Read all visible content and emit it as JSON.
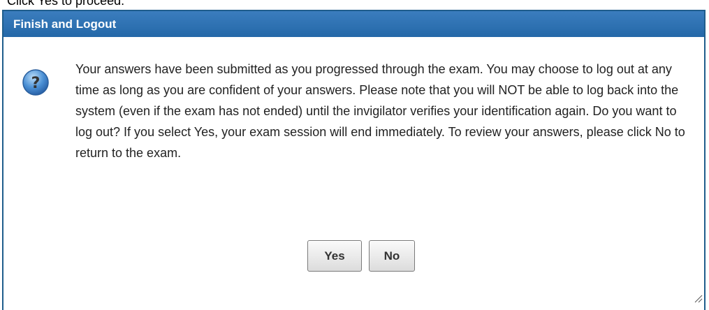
{
  "top_caption": "Click Yes to proceed.",
  "dialog": {
    "title": "Finish and Logout",
    "message": "Your answers have been submitted as you progressed through the exam. You may choose to log out at any time as long as you are confident of your answers. Please note that you will NOT be able to log back into the system (even if the exam has not ended) until the invigilator verifies your identification again. Do you want to log out? If you select Yes, your exam session will end immediately. To review your answers, please click No to return to the exam.",
    "buttons": {
      "yes_label": "Yes",
      "no_label": "No"
    },
    "icon": "question-icon"
  },
  "colors": {
    "title_bar": "#2a6fb0",
    "border": "#1f5d8c",
    "icon_blue": "#3a78c2"
  }
}
